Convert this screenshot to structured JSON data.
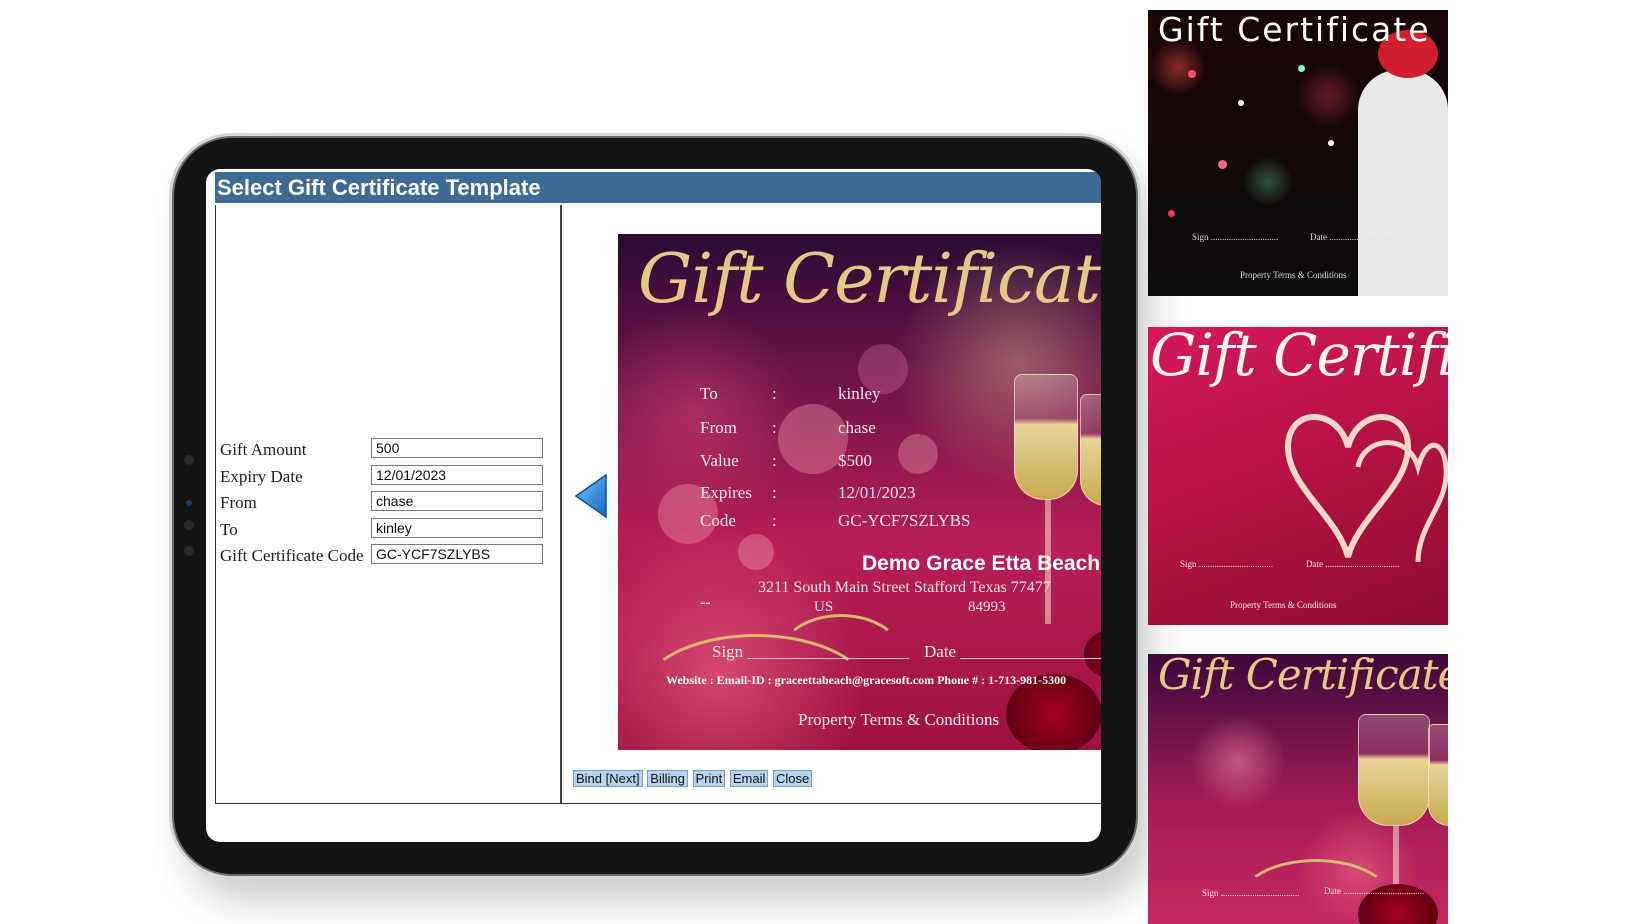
{
  "window": {
    "title": "Select Gift Certificate Template"
  },
  "form": {
    "fields": [
      {
        "label": "Gift Amount",
        "value": "500"
      },
      {
        "label": "Expiry Date",
        "value": "12/01/2023"
      },
      {
        "label": "From",
        "value": "chase"
      },
      {
        "label": "To",
        "value": "kinley"
      },
      {
        "label": "Gift Certificate Code",
        "value": "GC-YCF7SZLYBS"
      }
    ]
  },
  "certificate": {
    "title": "Gift Certificate",
    "rows": [
      {
        "key": "To",
        "sep": ":",
        "value": "kinley"
      },
      {
        "key": "From",
        "sep": ":",
        "value": "chase"
      },
      {
        "key": "Value",
        "sep": ":",
        "value": "$500"
      },
      {
        "key": "Expires",
        "sep": ":",
        "value": "12/01/2023"
      },
      {
        "key": "Code",
        "sep": ":",
        "value": "GC-YCF7SZLYBS"
      }
    ],
    "business_name": "Demo Grace Etta Beach",
    "address_line": "3211 South Main Street Stafford Texas 77477",
    "dash": "--",
    "country": "US",
    "zip_extra": "84993",
    "sign_label": "Sign",
    "sign_line": "___________________",
    "date_label": "Date",
    "date_line": "___________________",
    "contact": "Website :  Email-ID : graceettabeach@gracesoft.com Phone # : 1-713-981-5300",
    "terms": "Property Terms & Conditions"
  },
  "actions": [
    "Bind [Next]",
    "Billing",
    "Print",
    "Email",
    "Close"
  ],
  "thumbnails": [
    {
      "title": "Gift Certificate",
      "sign": "Sign ..............................",
      "date": "Date ..............................",
      "terms": "Property Terms & Conditions"
    },
    {
      "title": "Gift Certificate",
      "sign": "Sign .................................",
      "date": "Date .................................",
      "terms": "Property Terms & Conditions"
    },
    {
      "title": "Gift Certificate",
      "sign": "Sign ...................................",
      "date": "Date ...................................."
    }
  ],
  "colors": {
    "titlebar": "#3f6a96",
    "button_bg": "#b7d3ee",
    "gold": "#e6c785",
    "arrow": "#2d8fe0"
  },
  "icons": [
    "previous-arrow-icon"
  ]
}
